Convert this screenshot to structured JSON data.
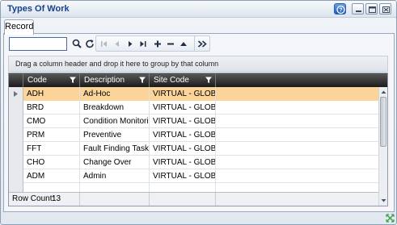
{
  "window": {
    "title": "Types Of Work",
    "help_icon": "help-icon",
    "minimize_icon": "minimize-icon",
    "restore_icon": "restore-icon",
    "close_icon": "close-icon"
  },
  "tabs": [
    {
      "label": "Record",
      "active": true
    }
  ],
  "toolbar": {
    "search_value": "",
    "icons": [
      "search-icon",
      "refresh-icon",
      "first-record-icon",
      "previous-record-icon",
      "next-record-icon",
      "last-record-icon",
      "add-icon",
      "delete-icon",
      "collapse-icon",
      "expand-icon"
    ]
  },
  "group_panel": {
    "text": "Drag a column header and drop it here to group by that column"
  },
  "grid": {
    "columns": [
      "Code",
      "Description",
      "Site Code"
    ],
    "rows": [
      {
        "code": "ADH",
        "description": "Ad-Hoc",
        "site_code": "VIRTUAL - GLOBAL",
        "selected": true
      },
      {
        "code": "BRD",
        "description": "Breakdown",
        "site_code": "VIRTUAL - GLOBAL",
        "selected": false
      },
      {
        "code": "CMO",
        "description": "Condition Monitoring",
        "site_code": "VIRTUAL - GLOBAL",
        "selected": false
      },
      {
        "code": "PRM",
        "description": "Preventive",
        "site_code": "VIRTUAL - GLOBAL",
        "selected": false
      },
      {
        "code": "FFT",
        "description": "Fault Finding Task",
        "site_code": "VIRTUAL - GLOBAL",
        "selected": false
      },
      {
        "code": "CHO",
        "description": "Change Over",
        "site_code": "VIRTUAL - GLOBAL",
        "selected": false
      },
      {
        "code": "ADM",
        "description": "Admin",
        "site_code": "VIRTUAL - GLOBAL",
        "selected": false
      }
    ],
    "footer": {
      "row_count_label": "Row Count:",
      "row_count_value": "13"
    }
  },
  "colors": {
    "title_text": "#15428b",
    "header_bg": "#2a2a2a",
    "selected_row": "#fbd49a",
    "window_bg": "#e2e8ef"
  }
}
